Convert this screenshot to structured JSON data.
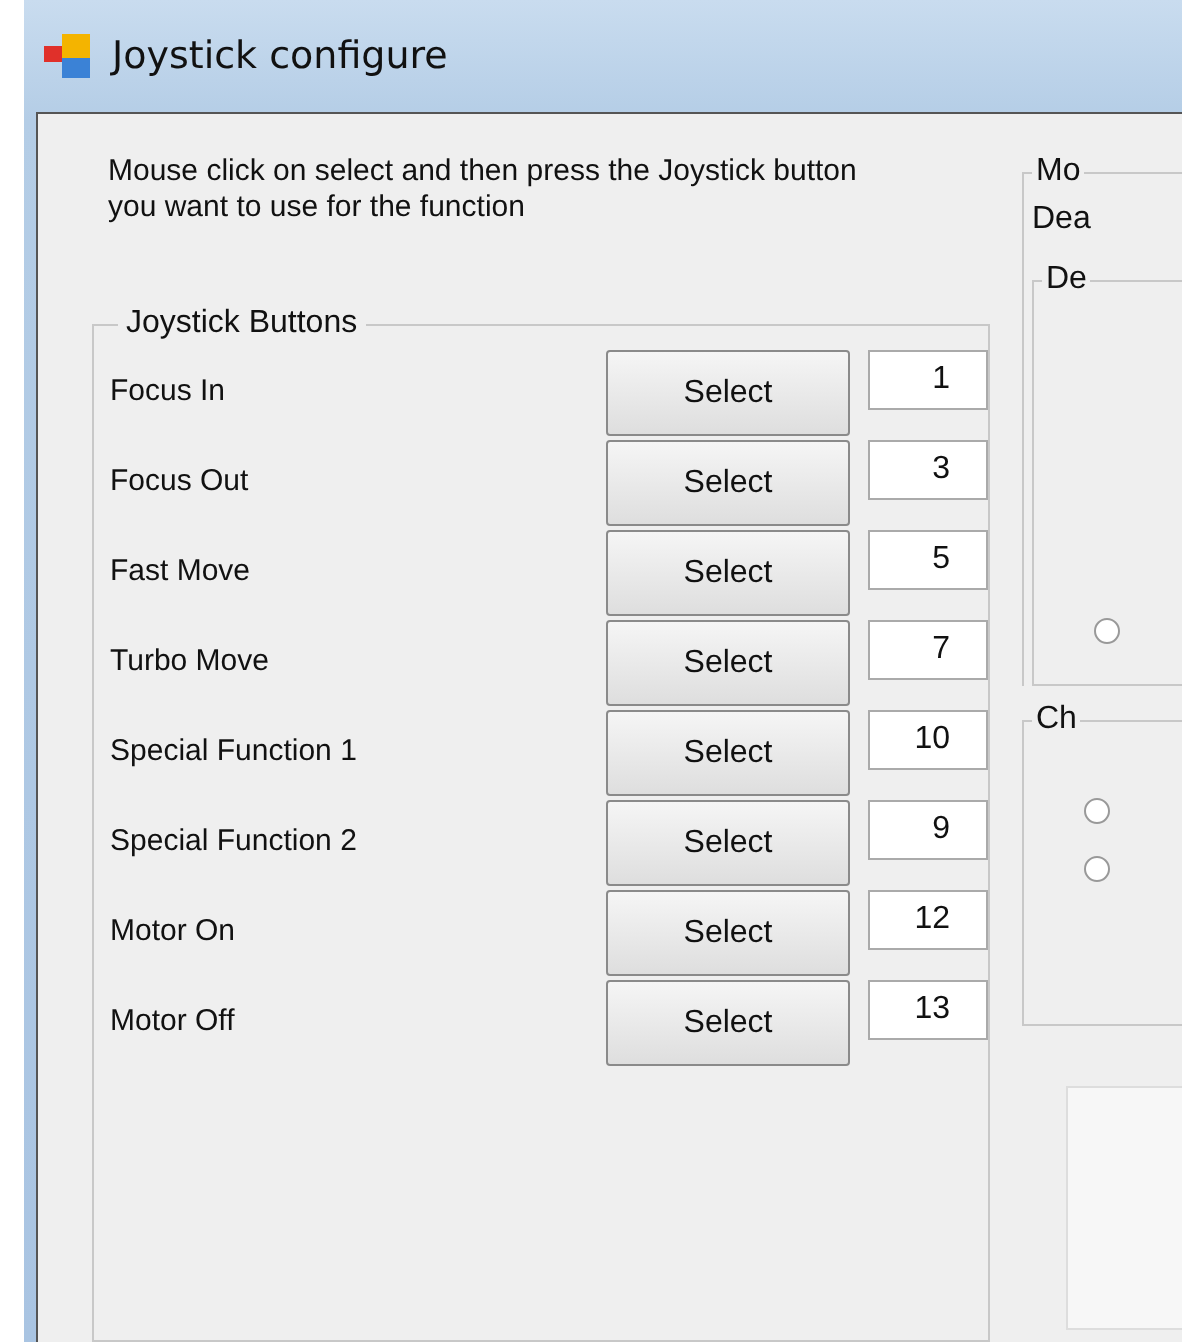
{
  "window": {
    "title": "Joystick configure"
  },
  "instructions": "Mouse click on select and then press the Joystick button you want to use for the function",
  "joystick_buttons": {
    "title": "Joystick Buttons",
    "rows": [
      {
        "label": "Focus In",
        "button": "Select",
        "value": "1"
      },
      {
        "label": "Focus Out",
        "button": "Select",
        "value": "3"
      },
      {
        "label": "Fast Move",
        "button": "Select",
        "value": "5"
      },
      {
        "label": "Turbo Move",
        "button": "Select",
        "value": "7"
      },
      {
        "label": "Special Function 1",
        "button": "Select",
        "value": "10"
      },
      {
        "label": "Special Function 2",
        "button": "Select",
        "value": "9"
      },
      {
        "label": "Motor On",
        "button": "Select",
        "value": "12"
      },
      {
        "label": "Motor Off",
        "button": "Select",
        "value": "13"
      }
    ]
  },
  "right_panel": {
    "group_title": "Mo",
    "label": "Dea",
    "inner_group_title": "De",
    "inner_radios": [
      {
        "checked": false
      }
    ],
    "second_group_title": "Ch",
    "second_radios": [
      {
        "checked": false
      },
      {
        "checked": false
      }
    ]
  }
}
